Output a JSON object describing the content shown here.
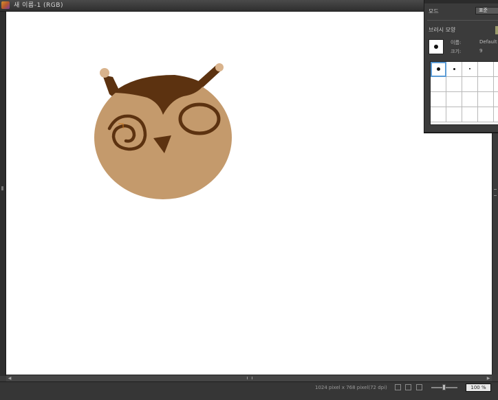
{
  "window": {
    "title": "새 이름-1 (RGB)"
  },
  "brush_panel": {
    "mode_label": "모드",
    "mode_value": "표준",
    "brush_shape_label": "브러시 모양",
    "name_label": "이름:",
    "name_value": "Default",
    "size_label": "크기:",
    "size_value": "9",
    "brushes": [
      {
        "dot": "large",
        "selected": true
      },
      {
        "dot": "medium",
        "selected": false
      },
      {
        "dot": "small",
        "selected": false
      },
      {
        "dot": "none",
        "selected": false
      },
      {
        "dot": "none",
        "selected": false
      }
    ]
  },
  "status_bar": {
    "dimensions": "1024 pixel x 768 pixel(72 dpi)",
    "zoom": "100 %"
  },
  "colors": {
    "owl_body": "#c49a6c",
    "owl_dark": "#5c3210",
    "owl_tuft_tip": "#d9b38c",
    "canvas": "#ffffff"
  }
}
